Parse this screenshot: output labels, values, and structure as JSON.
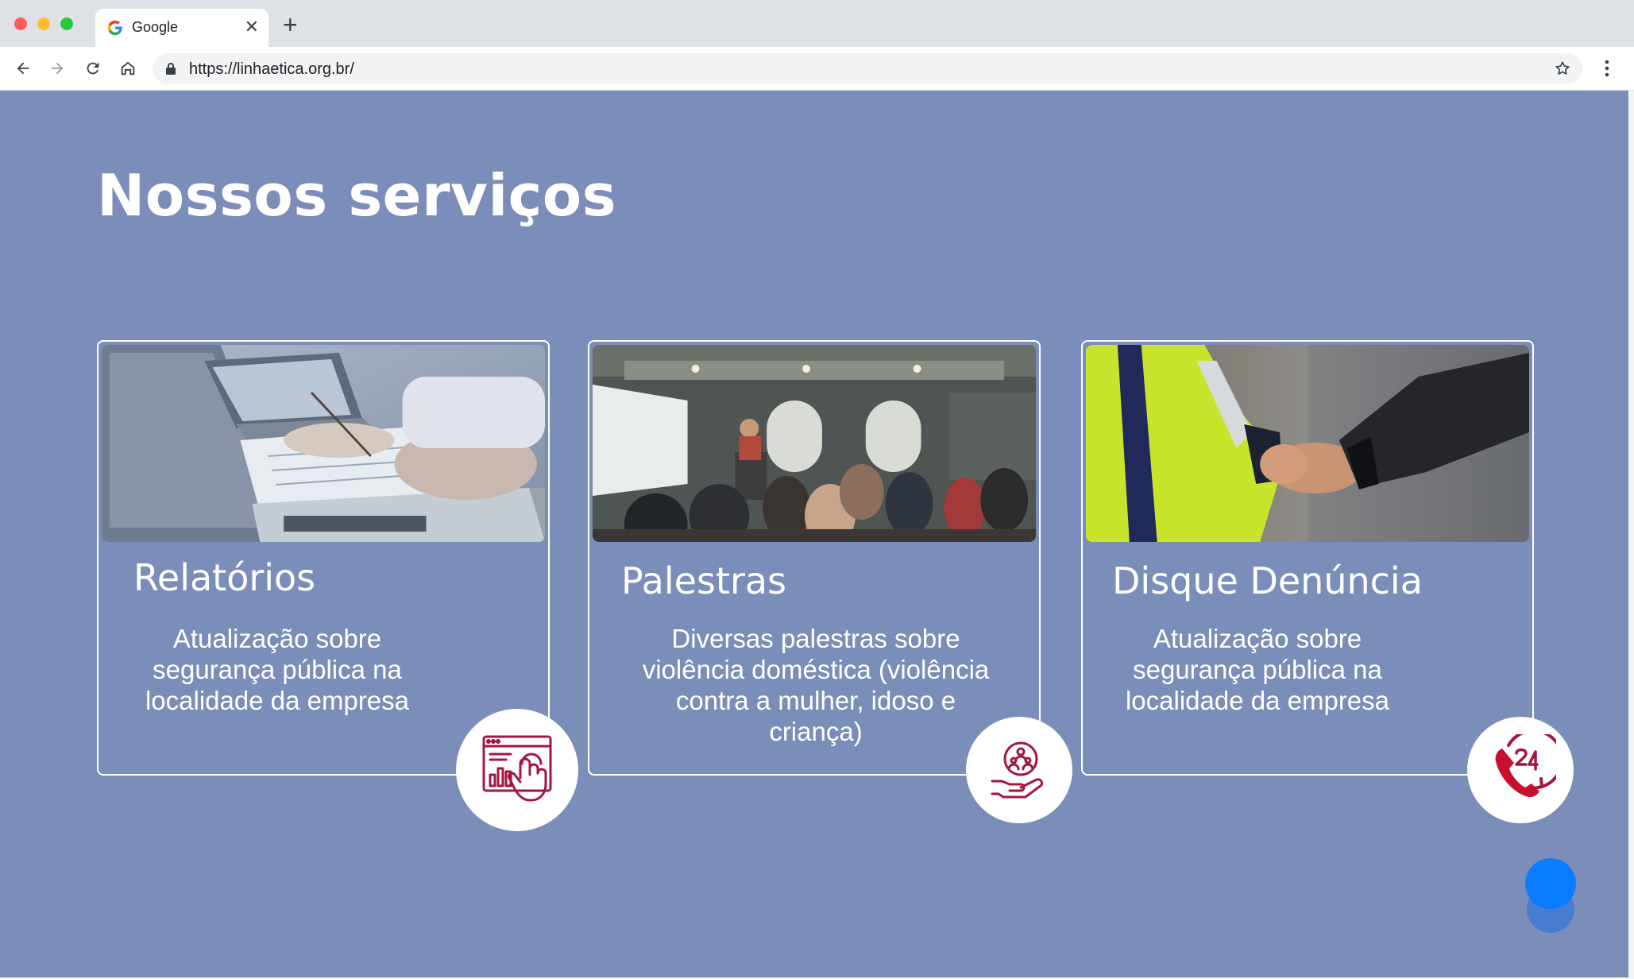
{
  "browser": {
    "tab_title": "Google",
    "url": "https://linhaetica.org.br/"
  },
  "page": {
    "section_title": "Nossos serviços",
    "cards": [
      {
        "title": "Relatórios",
        "description_lines": [
          "Atualização sobre",
          "segurança pública na",
          "localidade da empresa"
        ],
        "icon": "report-analytics-icon"
      },
      {
        "title": "Palestras",
        "description_lines": [
          "Diversas palestras sobre",
          "violência doméstica (violência",
          "contra a mulher, idoso e",
          "criança)"
        ],
        "icon": "community-care-icon"
      },
      {
        "title": "Disque Denúncia",
        "description_lines": [
          "Atualização sobre",
          "segurança pública na",
          "localidade da empresa"
        ],
        "icon": "phone-24h-icon"
      }
    ]
  },
  "colors": {
    "page_background": "#7b8eb9",
    "icon_accent": "#a3163f",
    "chat_button": "#0a7cff"
  }
}
